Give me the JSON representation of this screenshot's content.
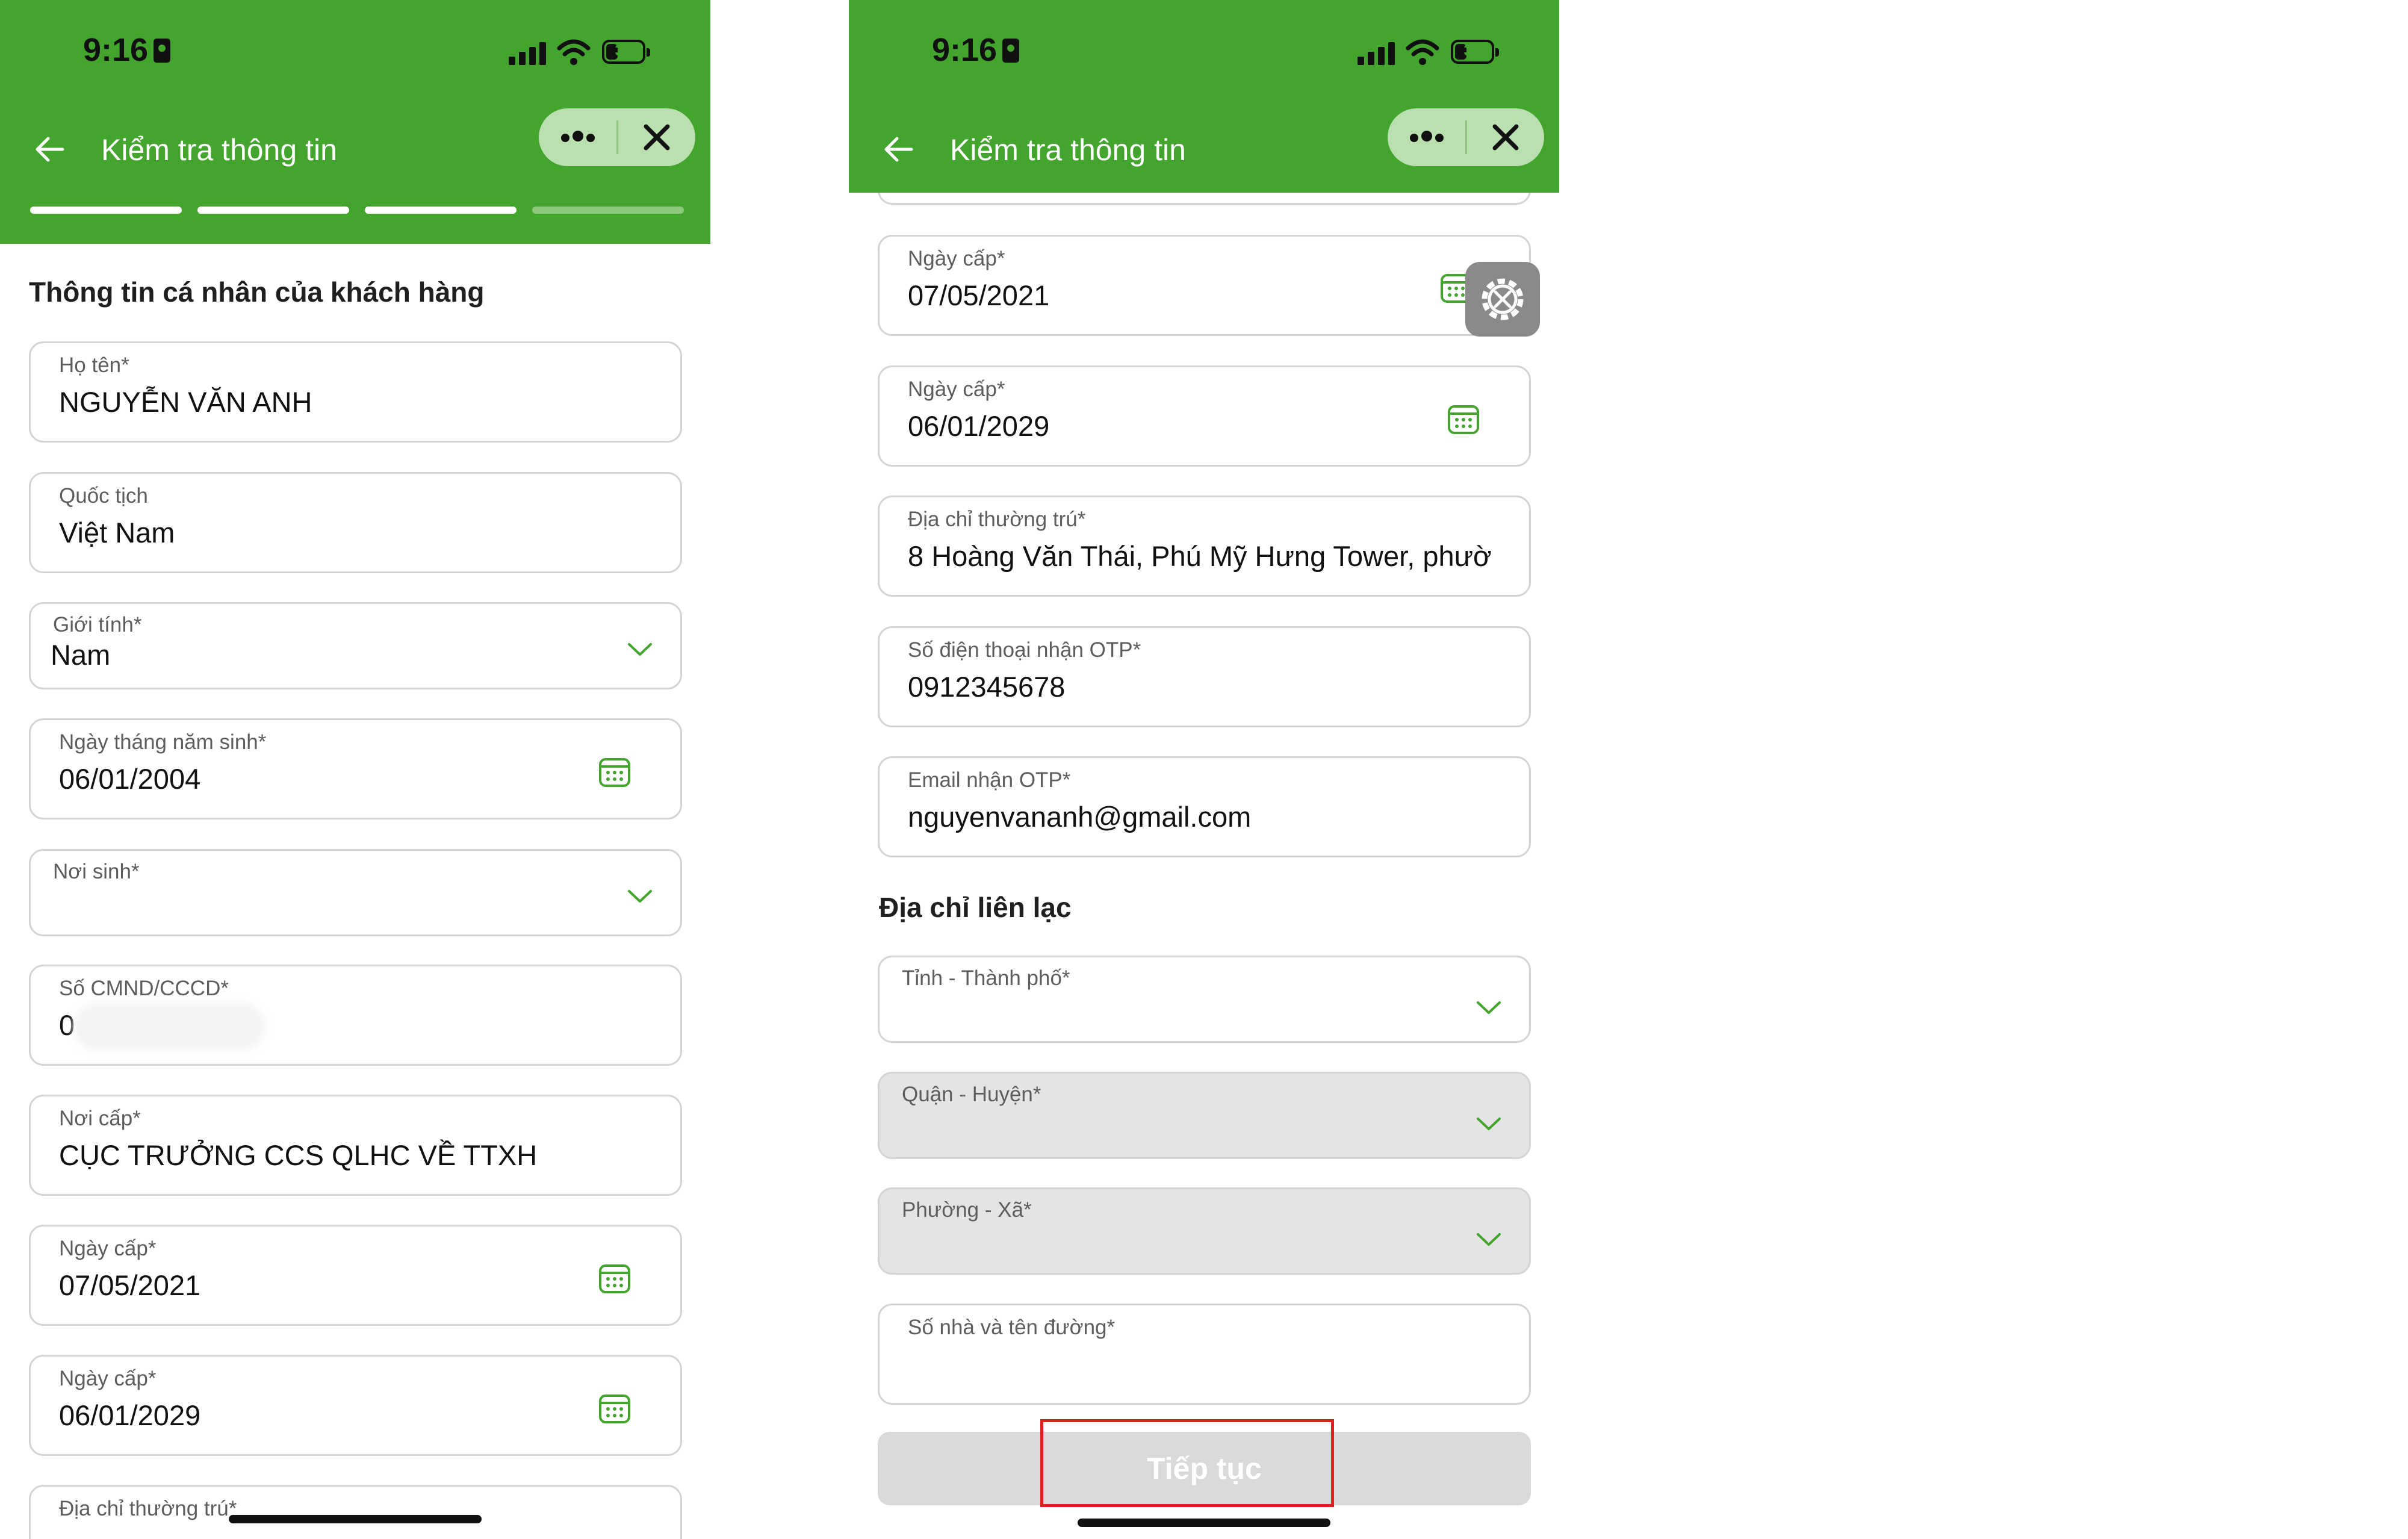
{
  "status_bar": {
    "time": "9:16",
    "battery_level": "30"
  },
  "header": {
    "title": "Kiểm tra thông tin",
    "progress_steps_done": 3,
    "progress_steps_total": 4
  },
  "colors": {
    "brand_green": "#44a52e",
    "progress_done": "#ffffff",
    "progress_todo": "#8cc97c",
    "chevron": "#44a52e",
    "highlight": "#e02020"
  },
  "left_screen": {
    "section_title": "Thông tin cá nhân của khách hàng",
    "fields": [
      {
        "label": "Họ tên*",
        "value": "NGUYỄN VĂN ANH"
      },
      {
        "label": "Quốc tịch",
        "value": "Việt Nam"
      },
      {
        "label": "Giới tính*",
        "value": "Nam",
        "icon": "chevron-down-icon"
      },
      {
        "label": "Ngày tháng năm sinh*",
        "value": "06/01/2004",
        "icon": "calendar-icon"
      },
      {
        "label": "Nơi sinh*",
        "value": "",
        "icon": "chevron-down-icon"
      },
      {
        "label": "Số CMND/CCCD*",
        "value": "0",
        "redacted": true
      },
      {
        "label": "Nơi cấp*",
        "value": "CỤC TRƯỞNG CCS QLHC VỀ TTXH"
      },
      {
        "label": "Ngày cấp*",
        "value": "07/05/2021",
        "icon": "calendar-icon"
      },
      {
        "label": "Ngày cấp*",
        "value": "06/01/2029",
        "icon": "calendar-icon"
      },
      {
        "label": "Địa chỉ thường trú*",
        "value": ""
      }
    ]
  },
  "right_screen": {
    "fields": [
      {
        "label": "Ngày cấp*",
        "value": "07/05/2021",
        "icon": "calendar-icon"
      },
      {
        "label": "Ngày cấp*",
        "value": "06/01/2029",
        "icon": "calendar-icon"
      },
      {
        "label": "Địa chỉ thường trú*",
        "value": "8 Hoàng Văn Thái, Phú Mỹ Hưng Tower, phườ"
      },
      {
        "label": "Số điện thoại nhận OTP*",
        "value": "0912345678"
      },
      {
        "label": "Email nhận OTP*",
        "value": "nguyenvananh@gmail.com"
      }
    ],
    "contact_section_title": "Địa chỉ liên lạc",
    "contact_fields": [
      {
        "label": "Tỉnh - Thành phố*",
        "value": "",
        "icon": "chevron-down-icon",
        "disabled": false
      },
      {
        "label": "Quận - Huyện*",
        "value": "",
        "icon": "chevron-down-icon",
        "disabled": true
      },
      {
        "label": "Phường - Xã*",
        "value": "",
        "icon": "chevron-down-icon",
        "disabled": true
      },
      {
        "label": "Số nhà và tên đường*",
        "value": "",
        "disabled": false
      }
    ],
    "continue_label": "Tiếp tục"
  }
}
